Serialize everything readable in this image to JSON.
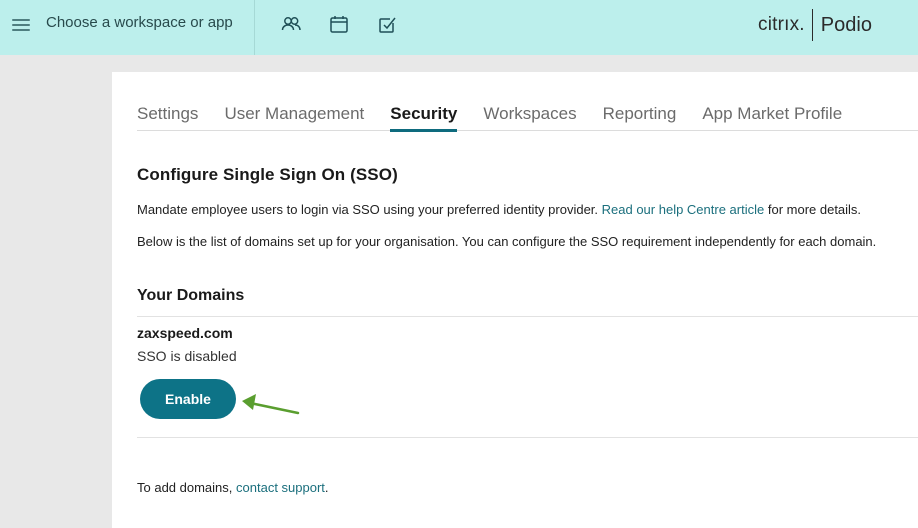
{
  "topbar": {
    "workspace_picker": "Choose a workspace or app",
    "icons": [
      "contacts-icon",
      "calendar-icon",
      "tasks-icon"
    ],
    "brand": {
      "citrix": "citrıx.",
      "product": "Podio"
    },
    "background": "#bcefec"
  },
  "tabs": [
    {
      "label": "Settings",
      "active": false
    },
    {
      "label": "User Management",
      "active": false
    },
    {
      "label": "Security",
      "active": true
    },
    {
      "label": "Workspaces",
      "active": false
    },
    {
      "label": "Reporting",
      "active": false
    },
    {
      "label": "App Market Profile",
      "active": false
    }
  ],
  "sso": {
    "title": "Configure Single Sign On (SSO)",
    "intro_before": "Mandate employee users to login via SSO using your preferred identity provider. ",
    "intro_link": "Read our help Centre article",
    "intro_after": " for more details.",
    "domains_desc": "Below is the list of domains set up for your organisation. You can configure the SSO requirement independently for each domain."
  },
  "domains": {
    "title": "Your Domains",
    "items": [
      {
        "name": "zaxspeed.com",
        "status": "SSO is disabled",
        "action": "Enable"
      }
    ]
  },
  "footer": {
    "text_before": "To add domains, ",
    "link": "contact support",
    "text_after": "."
  },
  "colors": {
    "accent": "#0d7387",
    "link": "#1b6f7d",
    "annotation_arrow": "#5a9e2f"
  }
}
